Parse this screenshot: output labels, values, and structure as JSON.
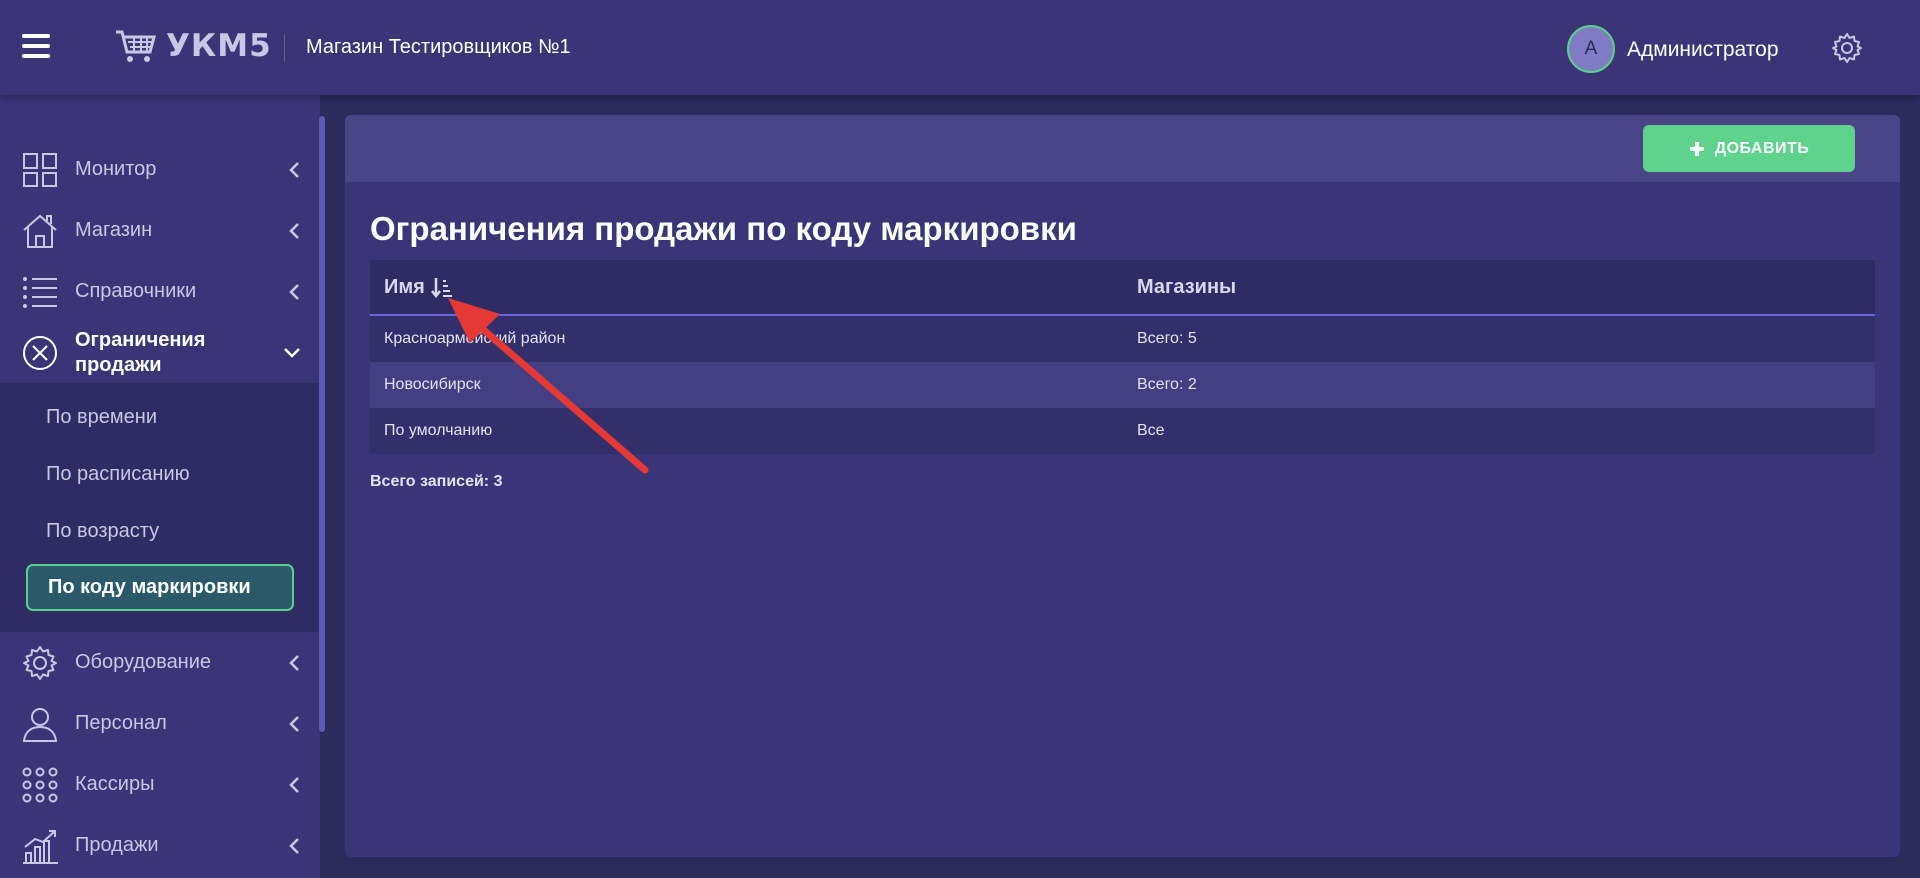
{
  "header": {
    "logo_text": "УКМ5",
    "store_name": "Магазин Тестировщиков №1",
    "avatar_letter": "А",
    "user_name": "Администратор"
  },
  "sidebar": {
    "items": [
      {
        "label": "Монитор",
        "icon": "monitor-grid-icon"
      },
      {
        "label": "Магазин",
        "icon": "home-icon"
      },
      {
        "label": "Справочники",
        "icon": "list-icon"
      },
      {
        "label": "Ограничения продажи",
        "icon": "x-circle-icon"
      },
      {
        "label": "Оборудование",
        "icon": "gear-icon"
      },
      {
        "label": "Персонал",
        "icon": "person-icon"
      },
      {
        "label": "Кассиры",
        "icon": "dots-grid-icon"
      },
      {
        "label": "Продажи",
        "icon": "chart-icon"
      }
    ],
    "submenu": [
      {
        "label": "По времени"
      },
      {
        "label": "По расписанию"
      },
      {
        "label": "По возрасту"
      },
      {
        "label": "По коду маркировки"
      }
    ]
  },
  "main": {
    "add_button": "ДОБАВИТЬ",
    "title": "Ограничения продажи по коду маркировки",
    "columns": [
      "Имя",
      "Магазины"
    ],
    "rows": [
      {
        "name": "Красноармейский район",
        "stores": "Всего: 5"
      },
      {
        "name": "Новосибирск",
        "stores": "Всего: 2"
      },
      {
        "name": "По умолчанию",
        "stores": "Все"
      }
    ],
    "total": "Всего записей: 3"
  },
  "colors": {
    "background": "#2d2a5e",
    "panel": "#3b3578",
    "accent_green": "#5fd38e",
    "annotation_arrow": "#e53935"
  }
}
